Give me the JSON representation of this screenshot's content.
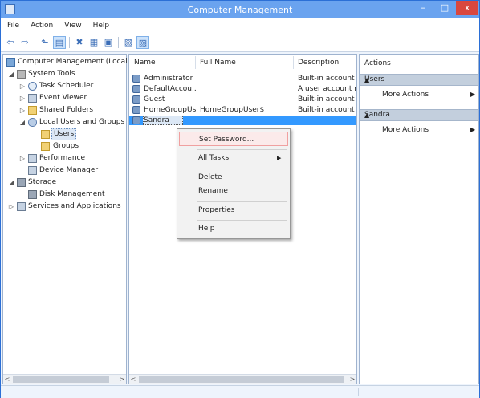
{
  "window": {
    "title": "Computer Management",
    "minimize_glyph": "–",
    "maximize_glyph": "□",
    "close_glyph": "x",
    "accent": "#6aa3ef",
    "close_color": "#d9473f"
  },
  "menu": [
    "File",
    "Action",
    "View",
    "Help"
  ],
  "toolbar": {
    "icons": [
      "back-arrow-icon",
      "forward-arrow-icon",
      "up-folder-icon",
      "show-hide-tree-icon",
      "delete-icon",
      "properties-icon",
      "refresh-icon",
      "export-list-icon",
      "help-icon",
      "show-hide-action-pane-icon"
    ],
    "glyphs": {
      "back": "⇦",
      "forward": "⇨",
      "up": "⬑",
      "tree": "▤",
      "delete": "✖",
      "properties": "▦",
      "refresh": "▣",
      "export": "▥",
      "help": "▧",
      "actionpane": "▨"
    }
  },
  "tree": {
    "root": "Computer Management (Local)",
    "items": [
      {
        "label": "System Tools",
        "expander": "◢",
        "icon": "tool"
      },
      {
        "label": "Task Scheduler",
        "expander": "▷",
        "icon": "clock"
      },
      {
        "label": "Event Viewer",
        "expander": "▷",
        "icon": "app"
      },
      {
        "label": "Shared Folders",
        "expander": "▷",
        "icon": "folder"
      },
      {
        "label": "Local Users and Groups",
        "expander": "◢",
        "icon": "users"
      },
      {
        "label": "Users",
        "expander": "",
        "icon": "folder"
      },
      {
        "label": "Groups",
        "expander": "",
        "icon": "folder"
      },
      {
        "label": "Performance",
        "expander": "▷",
        "icon": "app"
      },
      {
        "label": "Device Manager",
        "expander": "",
        "icon": "app"
      },
      {
        "label": "Storage",
        "expander": "◢",
        "icon": "disk"
      },
      {
        "label": "Disk Management",
        "expander": "",
        "icon": "disk"
      },
      {
        "label": "Services and Applications",
        "expander": "▷",
        "icon": "app"
      }
    ]
  },
  "list": {
    "columns": [
      "Name",
      "Full Name",
      "Description"
    ],
    "rows": [
      {
        "name": "Administrator",
        "full_name": "",
        "description": "Built-in account"
      },
      {
        "name": "DefaultAccou...",
        "full_name": "",
        "description": "A user account m"
      },
      {
        "name": "Guest",
        "full_name": "",
        "description": "Built-in account"
      },
      {
        "name": "HomeGroupUs...",
        "full_name": "HomeGroupUser$",
        "description": "Built-in account"
      },
      {
        "name": "Sandra",
        "full_name": "",
        "description": ""
      }
    ]
  },
  "context_menu": {
    "items": [
      "Set Password...",
      "All Tasks",
      "Delete",
      "Rename",
      "Properties",
      "Help"
    ],
    "submenu_arrow": "▶"
  },
  "actions": {
    "header": "Actions",
    "sections": [
      {
        "title": "Users",
        "collapse_glyph": "▲",
        "item": "More Actions",
        "arrow": "▶"
      },
      {
        "title": "Sandra",
        "collapse_glyph": "▲",
        "item": "More Actions",
        "arrow": "▶"
      }
    ]
  },
  "scroll": {
    "left": "<",
    "right": ">"
  }
}
